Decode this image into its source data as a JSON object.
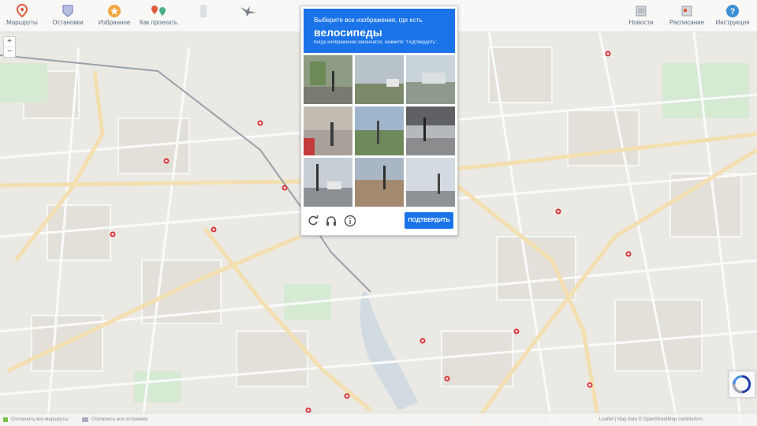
{
  "toolbar": {
    "items": [
      {
        "label": "Маршруты",
        "icon": "route-pin-icon"
      },
      {
        "label": "Остановки",
        "icon": "stop-shield-icon"
      },
      {
        "label": "Избранное",
        "icon": "favorites-star-icon"
      },
      {
        "label": "Как проехать",
        "icon": "directions-pins-icon"
      },
      {
        "label": "",
        "icon": "phone-icon"
      },
      {
        "label": "",
        "icon": "bird-logo-icon"
      }
    ],
    "right_items": [
      {
        "label": "Новости",
        "icon": "news-icon"
      },
      {
        "label": "Расписание",
        "icon": "schedule-icon"
      },
      {
        "label": "Инструкция",
        "icon": "help-icon"
      }
    ]
  },
  "zoom": {
    "in": "+",
    "out": "−"
  },
  "captcha": {
    "line1": "Выберите все изображения, где есть",
    "object": "велосипеды",
    "line2": "Когда изображения закончатся, нажмите \"Подтвердить\".",
    "verify_label": "ПОДТВЕРДИТЬ",
    "icons": [
      "reload-icon",
      "audio-headphones-icon",
      "info-icon"
    ],
    "tile_count": 9
  },
  "footer": {
    "left1": "Отключить все маршруты",
    "left2": "Отключить все остановки",
    "attribution": "Leaflet | Map data © OpenStreetMap contributors"
  },
  "colors": {
    "accent": "#1a73e8",
    "stop_marker": "#d9343a",
    "road": "#f6e3b8",
    "map_bg": "#eceae6"
  }
}
